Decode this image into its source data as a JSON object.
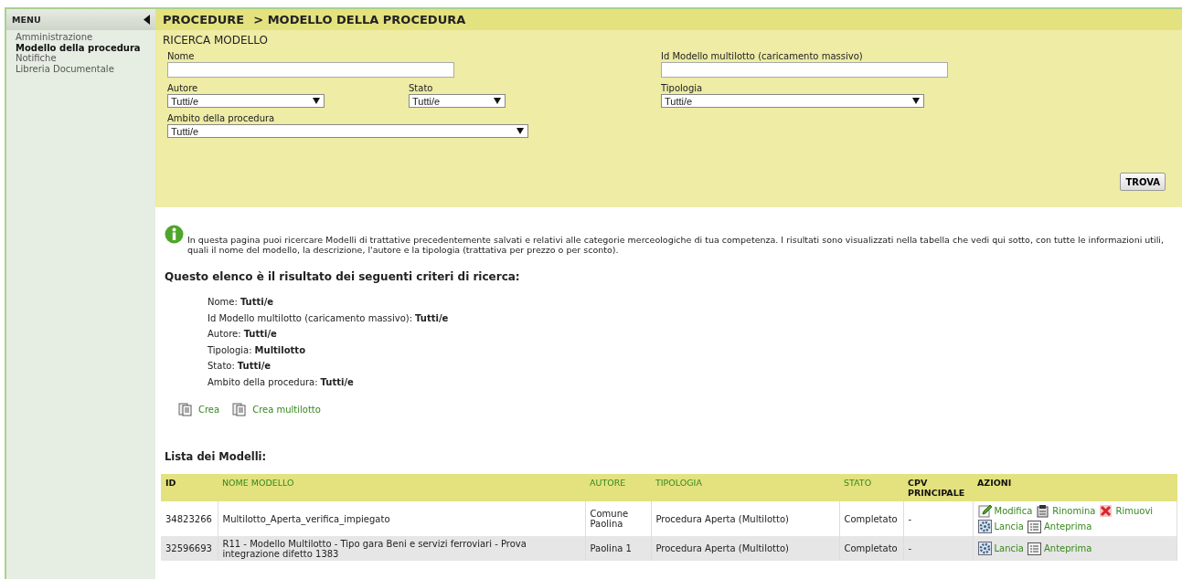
{
  "sidebar": {
    "title": "MENU",
    "items": [
      {
        "label": "Amministrazione",
        "selected": false
      },
      {
        "label": "Modello della procedura",
        "selected": true
      },
      {
        "label": "Notifiche",
        "selected": false
      },
      {
        "label": "Libreria Documentale",
        "selected": false
      }
    ]
  },
  "breadcrumb": [
    "PROCEDURE",
    "> MODELLO DELLA PROCEDURA"
  ],
  "search": {
    "title": "RICERCA MODELLO",
    "rows": [
      [
        {
          "kind": "text",
          "label": "Nome"
        },
        "",
        {
          "kind": "text",
          "label": "Id Modello multilotto (caricamento massivo)"
        }
      ],
      [
        {
          "kind": "select",
          "label": "Autore",
          "value": "Tutti/e"
        },
        {
          "kind": "select",
          "label": "Stato",
          "value": "Tutti/e"
        },
        {
          "kind": "select",
          "label": "Tipologia",
          "value": "Tutti/e"
        }
      ],
      [
        {
          "kind": "select",
          "label": "Ambito della procedura",
          "value": "Tutti/e"
        }
      ]
    ],
    "button": "TROVA"
  },
  "info": "In questa pagina puoi ricercare Modelli di trattative precedentemente salvati e relativi alle categorie merceologiche di tua competenza. I risultati sono visualizzati nella tabella che vedi qui sotto, con tutte le informazioni utili, quali il nome del modello, la descrizione, l'autore e la tipologia (trattativa per prezzo o per sconto).",
  "criteria": {
    "title": "Questo elenco è il risultato dei seguenti criteri di ricerca:",
    "items": [
      {
        "label": "Nome:",
        "value": "Tutti/e"
      },
      {
        "label": "Id Modello multilotto (caricamento massivo):",
        "value": "Tutti/e"
      },
      {
        "label": "Autore:",
        "value": "Tutti/e"
      },
      {
        "label": "Tipologia:",
        "value": "Multilotto"
      },
      {
        "label": "Stato:",
        "value": "Tutti/e"
      },
      {
        "label": "Ambito della procedura:",
        "value": "Tutti/e"
      }
    ]
  },
  "create_links": [
    "Crea",
    "Crea multilotto"
  ],
  "table": {
    "title": "Lista dei Modelli:",
    "columns": [
      {
        "label": "ID",
        "sortable": false
      },
      {
        "label": "NOME MODELLO",
        "sortable": true
      },
      {
        "label": "AUTORE",
        "sortable": true
      },
      {
        "label": "TIPOLOGIA",
        "sortable": true
      },
      {
        "label": "STATO",
        "sortable": true
      },
      {
        "label": "CPV PRINCIPALE",
        "sortable": false
      },
      {
        "label": "AZIONI",
        "sortable": false
      }
    ],
    "rows": [
      {
        "cells": [
          "34823266",
          "Multilotto_Aperta_verifica_impiegato",
          "Comune Paolina",
          "Procedura Aperta  (Multilotto)",
          "Completato",
          "-"
        ],
        "actions": [
          {
            "kind": "edit",
            "label": "Modifica"
          },
          {
            "kind": "rename",
            "label": "Rinomina"
          },
          {
            "kind": "remove",
            "label": "Rimuovi"
          },
          {
            "kind": "launch",
            "label": "Lancia"
          },
          {
            "kind": "preview",
            "label": "Anteprima"
          }
        ]
      },
      {
        "cells": [
          "32596693",
          "R11 - Modello Multilotto - Tipo gara Beni e servizi ferroviari - Prova integrazione difetto 1383",
          "Paolina 1",
          "Procedura Aperta  (Multilotto)",
          "Completato",
          "-"
        ],
        "actions": [
          {
            "kind": "launch",
            "label": "Lancia"
          },
          {
            "kind": "preview",
            "label": "Anteprima"
          }
        ]
      }
    ]
  }
}
